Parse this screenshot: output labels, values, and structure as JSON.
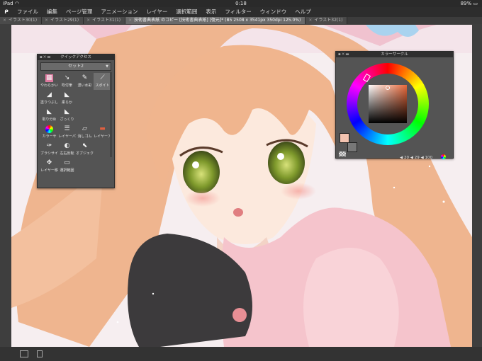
{
  "status": {
    "device": "iPad",
    "wifi": "wifi-icon",
    "time": "0:18",
    "battery": "89%"
  },
  "menu": {
    "logo": "clip-studio-logo",
    "items": [
      "ファイル",
      "編集",
      "ページ管理",
      "アニメーション",
      "レイヤー",
      "選択範囲",
      "表示",
      "フィルター",
      "ウィンドウ",
      "ヘルプ"
    ]
  },
  "tabs": [
    {
      "label": "イラスト30(1)",
      "active": false
    },
    {
      "label": "イラスト29(1)",
      "active": false
    },
    {
      "label": "イラスト31(1)",
      "active": false
    },
    {
      "label": "技術書典表紙 のコピー [技術書典表紙] [復元]* (B5 2508 x 3541px 350dpi 125.0%)",
      "active": true
    },
    {
      "label": "イラスト32(1)",
      "active": false
    }
  ],
  "quick_access": {
    "title": "クイックアクセス",
    "set": "セット2",
    "tools": [
      {
        "label": "やわらかい",
        "icon": "brush-soft-icon"
      },
      {
        "label": "吹付筆",
        "icon": "airbrush-icon"
      },
      {
        "label": "濃い水彩",
        "icon": "watercolor-icon"
      },
      {
        "label": "スポイト",
        "icon": "eyedropper-icon",
        "selected": true
      },
      {
        "label": "塗りつぶし",
        "icon": "fill-icon"
      },
      {
        "label": "柔らか",
        "icon": "soft-icon"
      },
      {
        "label": "",
        "icon": ""
      },
      {
        "label": "",
        "icon": ""
      },
      {
        "label": "取り分め",
        "icon": "blend-icon"
      },
      {
        "label": "ざっくり",
        "icon": "rough-icon"
      },
      {
        "label": "",
        "icon": ""
      },
      {
        "label": "",
        "icon": ""
      },
      {
        "label": "カラーサ",
        "icon": "color-wheel-icon"
      },
      {
        "label": "レイヤーパ",
        "icon": "layer-property-icon"
      },
      {
        "label": "消しゴム",
        "icon": "eraser-icon"
      },
      {
        "label": "レイヤーア",
        "icon": "layer-icon"
      },
      {
        "label": "ブラシサイ",
        "icon": "brush-size-icon"
      },
      {
        "label": "左右反転",
        "icon": "flip-icon"
      },
      {
        "label": "オブジェク",
        "icon": "object-icon"
      },
      {
        "label": "",
        "icon": ""
      },
      {
        "label": "レイヤー移",
        "icon": "move-layer-icon"
      },
      {
        "label": "選択範囲",
        "icon": "selection-icon"
      }
    ]
  },
  "color_circle": {
    "title": "カラーサークル",
    "main_color": "#f3c3b0",
    "sub_color": "#777777",
    "hue": "20",
    "sat": "29",
    "val": "100"
  },
  "colors": {
    "menubar": "#2d2d2d",
    "panel": "#545454",
    "accent": "#e8683a"
  }
}
